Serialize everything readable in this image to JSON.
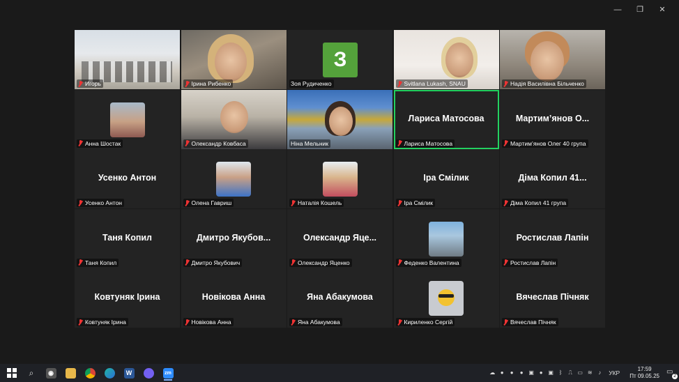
{
  "window_controls": {
    "minimize": "—",
    "restore": "❐",
    "close": "✕"
  },
  "tiles": [
    {
      "label": "Игорь"
    },
    {
      "label": "Ірина Рибенко"
    },
    {
      "label": "Зоя Рудиченко",
      "initial": "З"
    },
    {
      "label": "Svitlana Lukash, SNAU"
    },
    {
      "label": "Надія Василівна Більченко"
    },
    {
      "label": "Анна Шостак"
    },
    {
      "label": "Олександр Ковбаса"
    },
    {
      "label": "Ніна Мельник"
    },
    {
      "label": "Лариса Матосова",
      "big": "Лариса Матосова"
    },
    {
      "label": "Мартим’янов Олег 40 група",
      "big": "Мартим’янов О..."
    },
    {
      "label": "Усенко Антон",
      "big": "Усенко Антон"
    },
    {
      "label": "Олена Гавриш"
    },
    {
      "label": "Наталія Кошель"
    },
    {
      "label": "Іра Смілик",
      "big": "Іра Смілик"
    },
    {
      "label": "Діма Копил 41 група",
      "big": "Діма Копил 41..."
    },
    {
      "label": "Таня Копил",
      "big": "Таня Копил"
    },
    {
      "label": "Дмитро Якубович",
      "big": "Дмитро Якубов..."
    },
    {
      "label": "Олександр Яценко",
      "big": "Олександр Яце..."
    },
    {
      "label": "Феденко Валентина"
    },
    {
      "label": "Ростислав Лапін",
      "big": "Ростислав Лапін"
    },
    {
      "label": "Ковтуняк Ірина",
      "big": "Ковтуняк Ірина"
    },
    {
      "label": "Новікова Анна",
      "big": "Новікова Анна"
    },
    {
      "label": "Яна Абакумова",
      "big": "Яна Абакумова"
    },
    {
      "label": "Кириленко Сергій"
    },
    {
      "label": "Вячеслав Пічняк",
      "big": "Вячеслав Пічняк"
    }
  ],
  "taskbar": {
    "apps": [
      "search-icon",
      "camera-icon",
      "file-explorer-icon",
      "chrome-icon",
      "edge-icon",
      "word-icon",
      "viber-icon",
      "zoom-icon"
    ],
    "word_letter": "W",
    "zoom_letter": "zm",
    "language": "УКР",
    "time": "17:59",
    "date": "Пт 09.05.25",
    "notifications": "2"
  }
}
